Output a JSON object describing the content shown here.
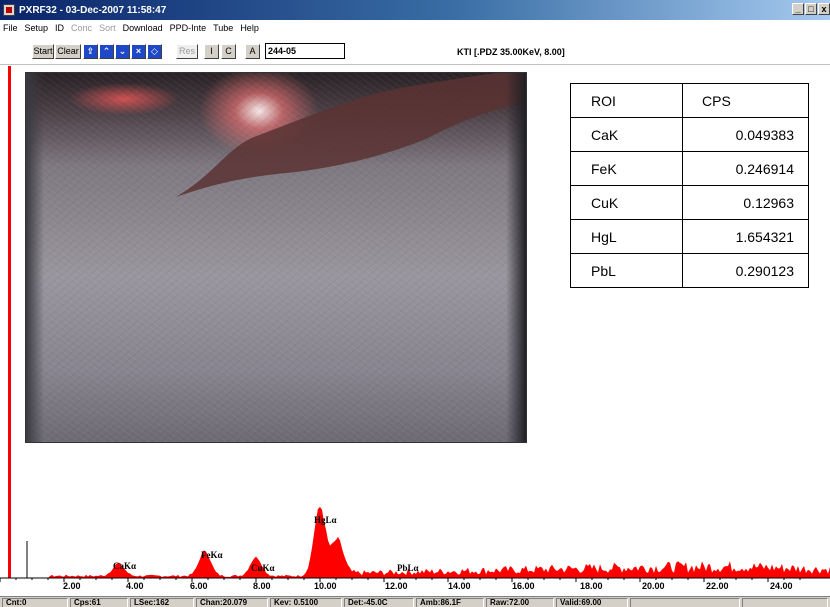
{
  "window": {
    "title": "PXRF32 - 03-Dec-2007 11:58:47",
    "controls": [
      "_",
      "□",
      "x"
    ]
  },
  "menu": [
    {
      "label": "File",
      "enabled": true
    },
    {
      "label": "Setup",
      "enabled": true
    },
    {
      "label": "ID",
      "enabled": true
    },
    {
      "label": "Conc",
      "enabled": false
    },
    {
      "label": "Sort",
      "enabled": false
    },
    {
      "label": "Download",
      "enabled": true
    },
    {
      "label": "PPD-Inte",
      "enabled": true
    },
    {
      "label": "Tube",
      "enabled": true
    },
    {
      "label": "Help",
      "enabled": true
    }
  ],
  "toolbar": {
    "start_label": "Start",
    "clear_label": "Clear",
    "res_label": "Res",
    "i_label": "I",
    "c_label": "C",
    "a_label": "A",
    "sample_id": "244-05",
    "tube_info": "KTI  [.PDZ 35.00KeV, 8.00]",
    "icons": [
      "open-icon",
      "up-arrow-icon",
      "down-arrow-icon",
      "cross-icon",
      "diamond-icon"
    ]
  },
  "roi_table": {
    "headers": [
      "ROI",
      "CPS"
    ],
    "rows": [
      [
        "CaK",
        "0.049383"
      ],
      [
        "FeK",
        "0.246914"
      ],
      [
        "CuK",
        "0.12963"
      ],
      [
        "HgL",
        "1.654321"
      ],
      [
        "PbL",
        "0.290123"
      ]
    ]
  },
  "peak_labels": [
    "CaKα",
    "FeKα",
    "CuKα",
    "HgLα",
    "PbLα"
  ],
  "chart_data": {
    "type": "area",
    "color": "#ff0000",
    "x_tick_labels": [
      "2.00",
      "4.00",
      "6.00",
      "8.00",
      "10.00",
      "12.00",
      "14.00",
      "16.00",
      "18.00",
      "20.00",
      "22.00",
      "24.00"
    ],
    "xlim": [
      0,
      25
    ],
    "peaks": [
      {
        "label": "CaKα",
        "kev": 3.7,
        "height": 0.1
      },
      {
        "label": "FeKα",
        "kev": 6.4,
        "height": 0.2
      },
      {
        "label": "CuKα",
        "kev": 8.0,
        "height": 0.15
      },
      {
        "label": "HgLα",
        "kev": 9.99,
        "height": 0.55
      },
      {
        "label": "PbLα",
        "kev": 10.55,
        "height": 0.27
      }
    ],
    "grid": false
  },
  "status": {
    "cnt": "Cnt:0",
    "cps": "Cps:61",
    "lsec": "LSec:162",
    "chan": "Chan:20.079",
    "kev": "Kev: 0.5100",
    "det": "Det:-45.0C",
    "amb": "Amb:86.1F",
    "raw": "Raw:72.00",
    "valid": "Valid:69.00"
  }
}
